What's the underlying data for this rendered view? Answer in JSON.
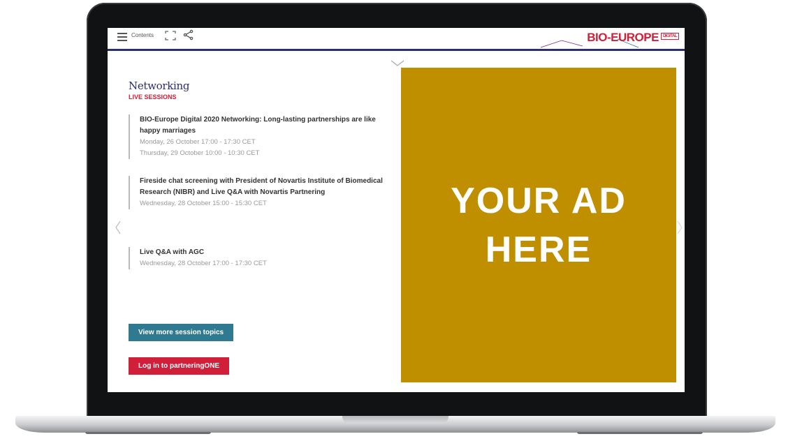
{
  "toolbar": {
    "contents_label": "Contents",
    "brand_name": "BIO-EUROPE",
    "brand_badge": "DIGITAL"
  },
  "main": {
    "heading": "Networking",
    "subheading": "LIVE SESSIONS",
    "sessions": [
      {
        "title": "BIO-Europe Digital 2020 Networking: Long-lasting partnerships are like happy marriages",
        "times": [
          "Monday, 26 October 17:00 - 17:30 CET",
          "Thursday, 29 October 10:00 - 10:30 CET"
        ]
      },
      {
        "title": "Fireside chat screening with President of Novartis Institute of Biomedical Research (NIBR) and Live Q&A with Novartis Partnering",
        "times": [
          "Wednesday, 28 October 15:00 - 15:30 CET"
        ]
      },
      {
        "title": "Live Q&A with AGC",
        "times": [
          "Wednesday, 28 October 17:00 - 17:30 CET"
        ]
      }
    ],
    "view_more_label": "View more session topics",
    "login_label": "Log in to partneringONE"
  },
  "ad": {
    "text": "YOUR AD HERE",
    "background": "#bf8f00"
  },
  "colors": {
    "brand_red": "#d11f3a",
    "navy": "#2b2f6e",
    "teal": "#2f7a91"
  }
}
